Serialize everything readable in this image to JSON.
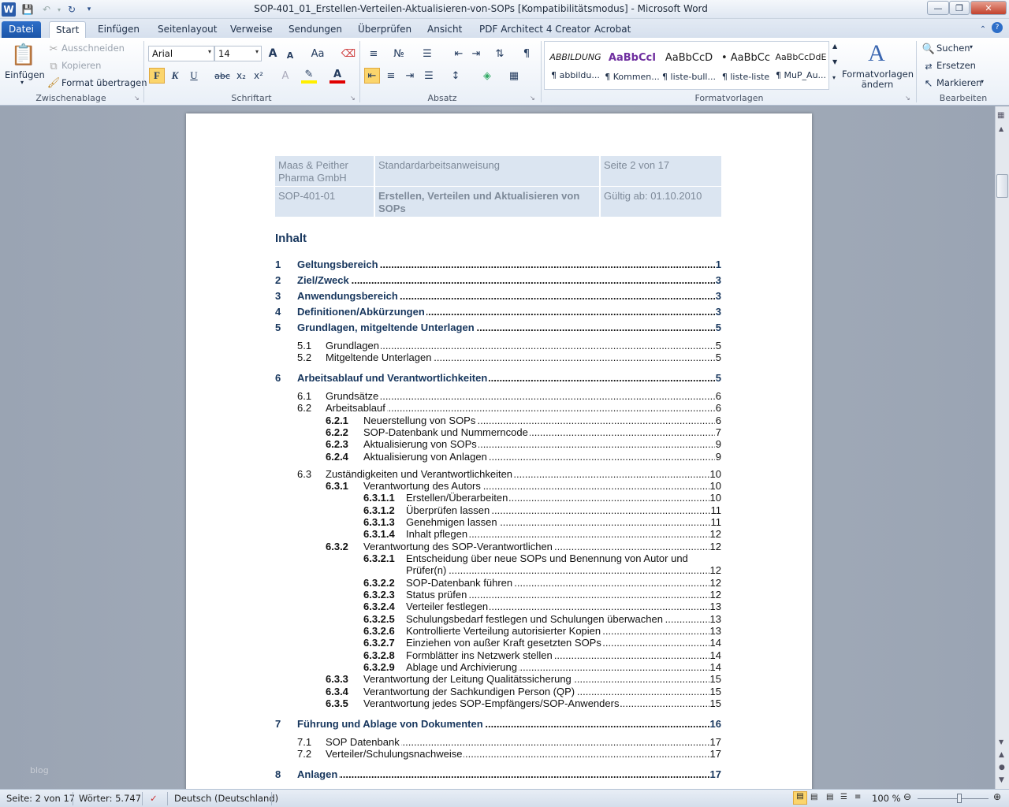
{
  "window": {
    "title": "SOP-401_01_Erstellen-Verteilen-Aktualisieren-von-SOPs [Kompatibilitätsmodus] - Microsoft Word",
    "app_icon": "W"
  },
  "tabs": [
    {
      "label": "Datei"
    },
    {
      "label": "Start"
    },
    {
      "label": "Einfügen"
    },
    {
      "label": "Seitenlayout"
    },
    {
      "label": "Verweise"
    },
    {
      "label": "Sendungen"
    },
    {
      "label": "Überprüfen"
    },
    {
      "label": "Ansicht"
    },
    {
      "label": "PDF Architect 4 Creator"
    },
    {
      "label": "Acrobat"
    }
  ],
  "ribbon": {
    "clipboard": {
      "paste": "Einfügen",
      "cut": "Ausschneiden",
      "copy": "Kopieren",
      "format_painter": "Format übertragen",
      "group": "Zwischenablage"
    },
    "font": {
      "family": "Arial",
      "size": "14",
      "bold": "F",
      "italic": "K",
      "underline": "U",
      "strike": "abc",
      "sub": "x₂",
      "sup": "x²",
      "group": "Schriftart",
      "grow": "A",
      "shrink": "A",
      "case": "Aa"
    },
    "paragraph": {
      "group": "Absatz"
    },
    "styles": {
      "group": "Formatvorlagen",
      "items": [
        {
          "preview": "ABBILDUNG",
          "name": "¶ abbildu..."
        },
        {
          "preview": "AaBbCcI",
          "name": "¶ Kommen..."
        },
        {
          "preview": "AaBbCcD",
          "name": "¶ liste-bull..."
        },
        {
          "preview": "• AaBbCc",
          "name": "¶ liste-liste"
        },
        {
          "preview": "AaBbCcDdE",
          "name": "¶ MuP_Au..."
        }
      ],
      "change_styles": "Formatvorlagen ändern"
    },
    "editing": {
      "group": "Bearbeiten",
      "find": "Suchen",
      "replace": "Ersetzen",
      "select": "Markieren"
    }
  },
  "header_table": {
    "r1c1": "Maas & Peither Pharma GmbH",
    "r1c2": "Standardarbeitsanweisung",
    "r1c3": "Seite 2 von 17",
    "r2c1": "SOP-401-01",
    "r2c2": "Erstellen, Verteilen und Aktualisieren von SOPs",
    "r2c3": "Gültig ab: 01.10.2010"
  },
  "toc_heading": "Inhalt",
  "toc": [
    {
      "lvl": 1,
      "num": "1",
      "text": "Geltungsbereich",
      "page": "1"
    },
    {
      "lvl": 1,
      "num": "2",
      "text": "Ziel/Zweck",
      "page": "3"
    },
    {
      "lvl": 1,
      "num": "3",
      "text": "Anwendungsbereich",
      "page": "3"
    },
    {
      "lvl": 1,
      "num": "4",
      "text": "Definitionen/Abkürzungen",
      "page": "3"
    },
    {
      "lvl": 1,
      "num": "5",
      "text": "Grundlagen, mitgeltende Unterlagen",
      "page": "5"
    },
    {
      "lvl": 2,
      "num": "5.1",
      "text": "Grundlagen",
      "page": "5"
    },
    {
      "lvl": 2,
      "num": "5.2",
      "text": "Mitgeltende Unterlagen",
      "page": "5"
    },
    {
      "lvl": 1,
      "num": "6",
      "text": "Arbeitsablauf und Verantwortlichkeiten",
      "page": "5"
    },
    {
      "lvl": 2,
      "num": "6.1",
      "text": "Grundsätze",
      "page": "6"
    },
    {
      "lvl": 2,
      "num": "6.2",
      "text": "Arbeitsablauf",
      "page": "6"
    },
    {
      "lvl": 3,
      "num": "6.2.1",
      "text": "Neuerstellung von SOPs",
      "page": "6"
    },
    {
      "lvl": 3,
      "num": "6.2.2",
      "text": "SOP-Datenbank und Nummerncode",
      "page": "7"
    },
    {
      "lvl": 3,
      "num": "6.2.3",
      "text": "Aktualisierung von SOPs",
      "page": "9"
    },
    {
      "lvl": 3,
      "num": "6.2.4",
      "text": "Aktualisierung von Anlagen",
      "page": "9"
    },
    {
      "lvl": 2,
      "num": "6.3",
      "text": "Zuständigkeiten und Verantwortlichkeiten",
      "page": "10"
    },
    {
      "lvl": 3,
      "num": "6.3.1",
      "text": "Verantwortung des Autors",
      "page": "10"
    },
    {
      "lvl": 4,
      "num": "6.3.1.1",
      "text": "Erstellen/Überarbeiten",
      "page": "10"
    },
    {
      "lvl": 4,
      "num": "6.3.1.2",
      "text": "Überprüfen lassen",
      "page": "11"
    },
    {
      "lvl": 4,
      "num": "6.3.1.3",
      "text": "Genehmigen lassen",
      "page": "11"
    },
    {
      "lvl": 4,
      "num": "6.3.1.4",
      "text": "Inhalt pflegen",
      "page": "12"
    },
    {
      "lvl": 3,
      "num": "6.3.2",
      "text": "Verantwortung des SOP-Verantwortlichen",
      "page": "12"
    },
    {
      "lvl": 4,
      "num": "6.3.2.1",
      "text": "Entscheidung über neue SOPs und Benennung von Autor und",
      "text2": "Prüfer(n)",
      "page": "12"
    },
    {
      "lvl": 4,
      "num": "6.3.2.2",
      "text": "SOP-Datenbank führen",
      "page": "12"
    },
    {
      "lvl": 4,
      "num": "6.3.2.3",
      "text": "Status prüfen",
      "page": "12"
    },
    {
      "lvl": 4,
      "num": "6.3.2.4",
      "text": "Verteiler festlegen",
      "page": "13"
    },
    {
      "lvl": 4,
      "num": "6.3.2.5",
      "text": "Schulungsbedarf festlegen und Schulungen überwachen",
      "page": "13"
    },
    {
      "lvl": 4,
      "num": "6.3.2.6",
      "text": "Kontrollierte Verteilung autorisierter Kopien",
      "page": "13"
    },
    {
      "lvl": 4,
      "num": "6.3.2.7",
      "text": "Einziehen von außer Kraft gesetzten SOPs",
      "page": "14"
    },
    {
      "lvl": 4,
      "num": "6.3.2.8",
      "text": "Formblätter ins Netzwerk stellen",
      "page": "14"
    },
    {
      "lvl": 4,
      "num": "6.3.2.9",
      "text": "Ablage und Archivierung",
      "page": "14"
    },
    {
      "lvl": 3,
      "num": "6.3.3",
      "text": "Verantwortung der Leitung Qualitätssicherung",
      "page": "15"
    },
    {
      "lvl": 3,
      "num": "6.3.4",
      "text": "Verantwortung der Sachkundigen Person (QP)",
      "page": "15"
    },
    {
      "lvl": 3,
      "num": "6.3.5",
      "text": "Verantwortung jedes SOP-Empfängers/SOP-Anwenders",
      "page": "15"
    },
    {
      "lvl": 1,
      "num": "7",
      "text": "Führung und Ablage von Dokumenten",
      "page": "16"
    },
    {
      "lvl": 2,
      "num": "7.1",
      "text": "SOP Datenbank",
      "page": "17"
    },
    {
      "lvl": 2,
      "num": "7.2",
      "text": "Verteiler/Schulungsnachweise",
      "page": "17"
    },
    {
      "lvl": 1,
      "num": "8",
      "text": "Anlagen",
      "page": "17"
    }
  ],
  "watermark": "blog",
  "status": {
    "page": "Seite: 2 von 17",
    "words": "Wörter: 5.747",
    "language": "Deutsch (Deutschland)",
    "zoom": "100 %"
  }
}
